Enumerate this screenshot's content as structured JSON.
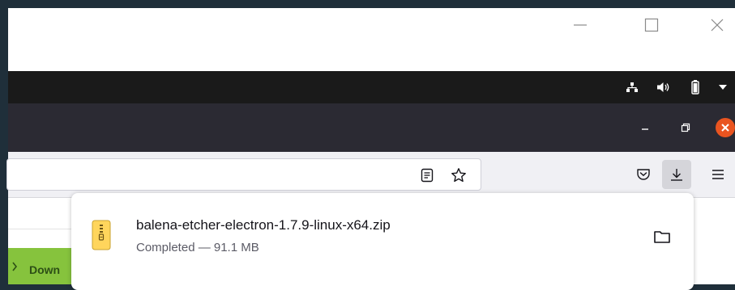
{
  "firefox": {
    "downloads_panel": {
      "items": [
        {
          "filename": "balena-etcher-electron-1.7.9-linux-x64.zip",
          "status": "Completed — 91.1 MB"
        }
      ]
    }
  },
  "page": {
    "button_label_partial": "Down"
  },
  "colors": {
    "outer_bg": "#1f2f3a",
    "top_panel": "#1a1a1a",
    "firefox_header": "#2b2a33",
    "toolbar": "#f0f0f4",
    "close_accent": "#e95420",
    "page_green": "#86c33d",
    "zip_icon": "#ffd55c"
  },
  "icons": [
    "minimize-icon",
    "maximize-icon",
    "close-icon",
    "network-icon",
    "volume-icon",
    "battery-icon",
    "system-menu-arrow-icon",
    "reader-view-icon",
    "bookmark-star-icon",
    "pocket-icon",
    "download-icon",
    "app-menu-icon",
    "zip-file-icon",
    "folder-icon"
  ]
}
